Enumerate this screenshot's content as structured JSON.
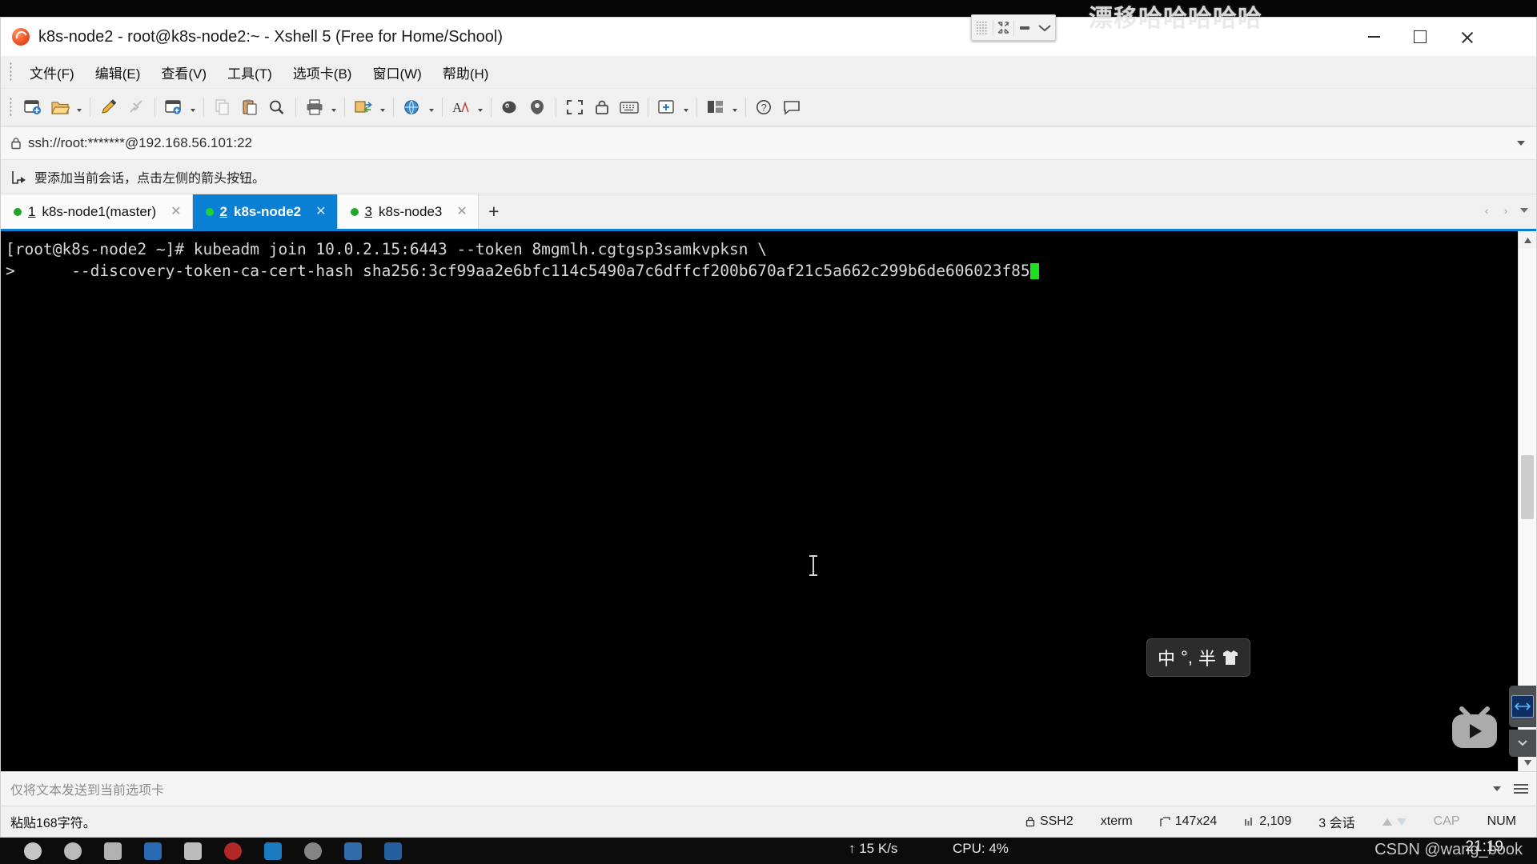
{
  "window": {
    "title": "k8s-node2 - root@k8s-node2:~ - Xshell 5 (Free for Home/School)",
    "minimize_label": "最小化",
    "maximize_label": "最大化",
    "close_label": "关闭"
  },
  "watermark": {
    "top_text": "漂移哈哈哈哈哈",
    "csdn_text": "CSDN @wang_book"
  },
  "float_toolbar": {
    "grid_label": "网格",
    "collapse_label": "收起",
    "minimize_label": "最小化",
    "expand_label": "展开"
  },
  "menu": {
    "items": [
      {
        "label": "文件(F)"
      },
      {
        "label": "编辑(E)"
      },
      {
        "label": "查看(V)"
      },
      {
        "label": "工具(T)"
      },
      {
        "label": "选项卡(B)"
      },
      {
        "label": "窗口(W)"
      },
      {
        "label": "帮助(H)"
      }
    ]
  },
  "toolbar": {
    "items": [
      {
        "name": "new-session-icon",
        "label": "新建会话"
      },
      {
        "name": "open-folder-icon",
        "label": "打开"
      },
      {
        "name": "edit-session-icon",
        "label": "属性"
      },
      {
        "name": "disconnect-icon",
        "label": "断开"
      },
      {
        "name": "session-manager-icon",
        "label": "会话管理器"
      },
      {
        "name": "copy-icon",
        "label": "复制"
      },
      {
        "name": "paste-icon",
        "label": "粘贴"
      },
      {
        "name": "find-icon",
        "label": "查找"
      },
      {
        "name": "print-icon",
        "label": "打印"
      },
      {
        "name": "transfer-icon",
        "label": "文件传输"
      },
      {
        "name": "globe-icon",
        "label": "浏览"
      },
      {
        "name": "font-icon",
        "label": "字体"
      },
      {
        "name": "quick-command-icon",
        "label": "快速命令"
      },
      {
        "name": "compose-pane-icon",
        "label": "编写窗格"
      },
      {
        "name": "fullscreen-icon",
        "label": "全屏"
      },
      {
        "name": "lock-icon",
        "label": "锁定"
      },
      {
        "name": "keyboard-icon",
        "label": "键盘"
      },
      {
        "name": "add-tab-icon",
        "label": "新建标签"
      },
      {
        "name": "layout-icon",
        "label": "布局"
      },
      {
        "name": "help-icon",
        "label": "帮助"
      },
      {
        "name": "chat-icon",
        "label": "反馈"
      }
    ]
  },
  "address_bar": {
    "value": "ssh://root:*******@192.168.56.101:22",
    "lock_icon": "lock-icon",
    "dropdown_icon": "chevron-down-icon"
  },
  "notice_bar": {
    "icon": "add-session-icon",
    "text": "要添加当前会话，点击左侧的箭头按钮。"
  },
  "tabs": {
    "items": [
      {
        "num": "1",
        "label": "k8s-node1(master)",
        "active": false,
        "status": "connected"
      },
      {
        "num": "2",
        "label": "k8s-node2",
        "active": true,
        "status": "connected"
      },
      {
        "num": "3",
        "label": "k8s-node3",
        "active": false,
        "status": "connected"
      }
    ],
    "add_label": "+",
    "scroll_left": "‹",
    "scroll_right": "›"
  },
  "terminal": {
    "lines": [
      "[root@k8s-node2 ~]# kubeadm join 10.0.2.15:6443 --token 8mgmlh.cgtgsp3samkvpksn \\",
      ">      --discovery-token-ca-cert-hash sha256:3cf99aa2e6bfc114c5490a7c6dffcf200b670af21c5a662c299b6de606023f85"
    ],
    "prompt_user": "root",
    "prompt_host": "k8s-node2",
    "cursor_color": "#1fe01f",
    "bg_color": "#000000",
    "fg_color": "#d8d8d8"
  },
  "ime": {
    "mode": "中",
    "punct": "°,",
    "width": "半",
    "icon": "shirt-icon"
  },
  "send_bar": {
    "text": "仅将文本发送到当前选项卡",
    "dropdown_icon": "chevron-down-icon",
    "menu_icon": "hamburger-icon"
  },
  "status_bar": {
    "message": "粘贴168字符。",
    "protocol": "SSH2",
    "terminal_type": "xterm",
    "size": "147x24",
    "bytes": "2,109",
    "sessions": "3 会话",
    "cap": "CAP",
    "num": "NUM"
  },
  "taskbar": {
    "net_speed": "↑ 15 K/s",
    "cpu": "CPU: 4%",
    "clock": "21:19"
  },
  "overlay_widgets": {
    "bilibili_label": "bilibili-logo",
    "resize_label": "resize-widget",
    "collapse_label": "collapse-widget"
  },
  "colors": {
    "accent": "#0a7fd4",
    "terminal_bg": "#000000",
    "terminal_fg": "#d8d8d8",
    "cursor": "#1fe01f",
    "chrome": "#f0f0f0"
  }
}
